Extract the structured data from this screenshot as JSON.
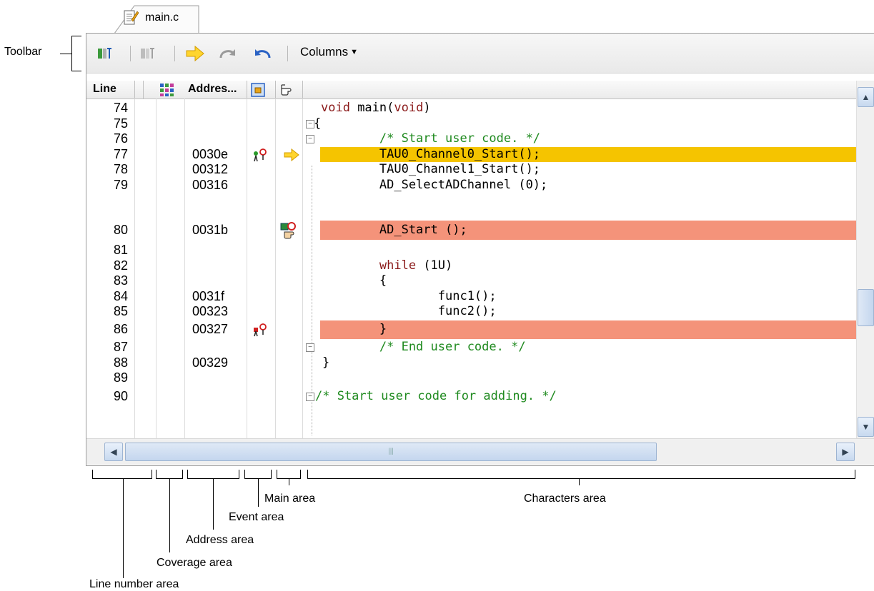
{
  "editor": {
    "tab_label": "main.c",
    "toolbar": {
      "columns_label": "Columns",
      "icons": [
        "go-to-source-icon",
        "disassemble-icon",
        "show-current-pc-icon",
        "forward-to-next-history-icon",
        "back-to-last-history-icon"
      ]
    },
    "columns": {
      "line_label": "Line",
      "address_label": "Addres..."
    },
    "rows": [
      {
        "line": "74",
        "address": "",
        "code": "void main(void)",
        "style": "plain"
      },
      {
        "line": "75",
        "address": "",
        "code": "{",
        "style": "plain"
      },
      {
        "line": "76",
        "address": "",
        "code": "        /* Start user code. */",
        "style": "comment"
      },
      {
        "line": "77",
        "address": "0030e",
        "code": "        TAU0_Channel0_Start();",
        "style": "plain"
      },
      {
        "line": "78",
        "address": "00312",
        "code": "        TAU0_Channel1_Start();",
        "style": "plain"
      },
      {
        "line": "79",
        "address": "00316",
        "code": "        AD_SelectADChannel (0);",
        "style": "plain"
      },
      {
        "line": "80",
        "address": "0031b",
        "code": "        AD_Start ();",
        "style": "plain"
      },
      {
        "line": "81",
        "address": "",
        "code": "",
        "style": "plain"
      },
      {
        "line": "82",
        "address": "",
        "code": "        while (1U)",
        "style": "plain"
      },
      {
        "line": "83",
        "address": "",
        "code": "        {",
        "style": "plain"
      },
      {
        "line": "84",
        "address": "0031f",
        "code": "                func1();",
        "style": "plain"
      },
      {
        "line": "85",
        "address": "00323",
        "code": "                func2();",
        "style": "plain"
      },
      {
        "line": "86",
        "address": "00327",
        "code": "        }",
        "style": "plain"
      },
      {
        "line": "87",
        "address": "",
        "code": "        /* End user code. */",
        "style": "comment"
      },
      {
        "line": "88",
        "address": "00329",
        "code": "}",
        "style": "plain"
      },
      {
        "line": "89",
        "address": "",
        "code": "",
        "style": "plain"
      },
      {
        "line": "90",
        "address": "",
        "code": "/* Start user code for adding. */",
        "style": "comment"
      }
    ]
  },
  "annotations": {
    "toolbar": "Toolbar",
    "main_area": "Main area",
    "characters_area": "Characters area",
    "event_area": "Event area",
    "address_area": "Address area",
    "coverage_area": "Coverage area",
    "line_number_area": "Line number area"
  },
  "colors": {
    "current_pc_highlight": "#f5c400",
    "breakpoint_highlight": "#f4937a",
    "keyword": "#8b1a1a",
    "comment": "#1f8a1f"
  }
}
